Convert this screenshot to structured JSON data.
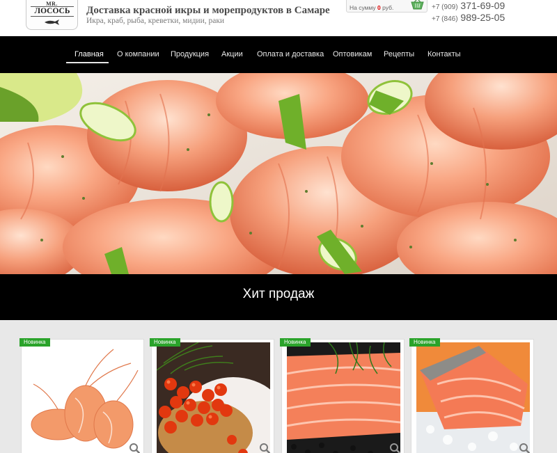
{
  "header": {
    "logo": {
      "line1": "MR.",
      "line2": "ЛОСОСЬ"
    },
    "title": "Доставка красной икры и морепродуктов в Самаре",
    "subtitle": "Икра, краб, рыба, креветки, мидии, раки",
    "cart": {
      "label_prefix": "На сумму",
      "sum": "0",
      "currency": "руб."
    },
    "phones": [
      {
        "code": "+7 (909)",
        "number": "371-69-09"
      },
      {
        "code": "+7 (846)",
        "number": "989-25-05"
      }
    ]
  },
  "nav": {
    "items": [
      "Главная",
      "О компании",
      "Продукция",
      "Акции",
      "Оплата и доставка",
      "Оптовикам",
      "Рецепты",
      "Контакты"
    ],
    "active_index": 0
  },
  "section": {
    "title": "Хит продаж"
  },
  "products": [
    {
      "badge": "Новинка",
      "image": "shrimp"
    },
    {
      "badge": "Новинка",
      "image": "red-caviar"
    },
    {
      "badge": "Новинка",
      "image": "salmon-fillet"
    },
    {
      "badge": "Новинка",
      "image": "salmon-steak"
    }
  ],
  "colors": {
    "nav_bg": "#000000",
    "badge": "#2aa32a",
    "cart_sum": "#dd0000",
    "products_bg": "#e8e8e8"
  }
}
